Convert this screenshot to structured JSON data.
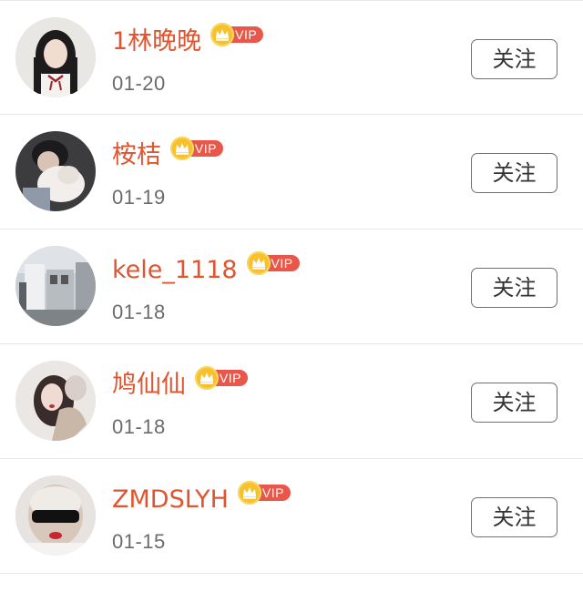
{
  "colors": {
    "name": "#e0552f",
    "vip_pill": "#e8574a",
    "vip_crown": "#f6c12b",
    "date": "#6b6b6b",
    "divider": "#e8e8e8"
  },
  "users": [
    {
      "name": "1林晚晚",
      "vip_label": "VIP",
      "date": "01-20",
      "follow_label": "关注",
      "avatar": "avatar-girl-white-shirt"
    },
    {
      "name": "桉桔",
      "vip_label": "VIP",
      "date": "01-19",
      "follow_label": "关注",
      "avatar": "avatar-person-with-dog"
    },
    {
      "name": "kele_1118",
      "vip_label": "VIP",
      "date": "01-18",
      "follow_label": "关注",
      "avatar": "avatar-street-photo"
    },
    {
      "name": "鸠仙仙",
      "vip_label": "VIP",
      "date": "01-18",
      "follow_label": "关注",
      "avatar": "avatar-girl-with-hood"
    },
    {
      "name": "ZMDSLYH",
      "vip_label": "VIP",
      "date": "01-15",
      "follow_label": "关注",
      "avatar": "avatar-sunglasses"
    }
  ]
}
